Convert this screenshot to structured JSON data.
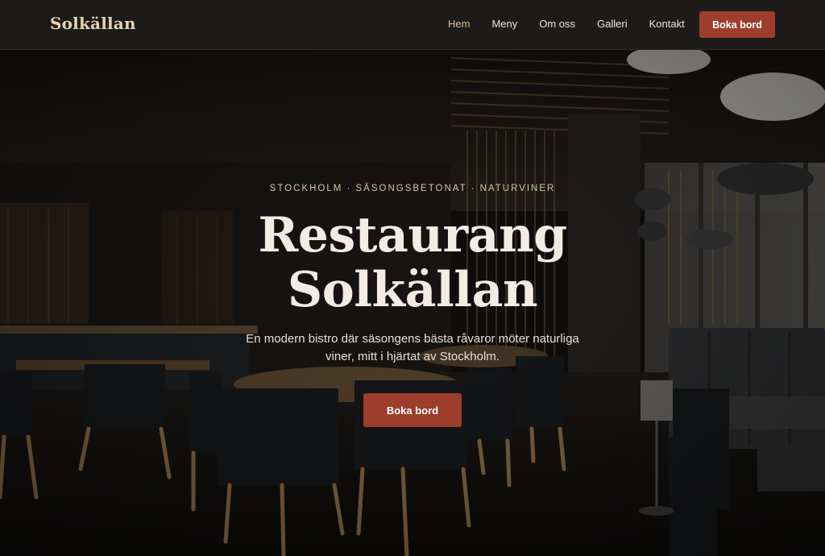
{
  "brand": {
    "name": "Solkällan"
  },
  "nav": {
    "items": [
      {
        "label": "Hem",
        "active": true
      },
      {
        "label": "Meny",
        "active": false
      },
      {
        "label": "Om oss",
        "active": false
      },
      {
        "label": "Galleri",
        "active": false
      },
      {
        "label": "Kontakt",
        "active": false
      }
    ],
    "cta_label": "Boka bord"
  },
  "hero": {
    "eyebrow": "STOCKHOLM · SÄSONGSBETONAT · NATURVINER",
    "title_line1": "Restaurang",
    "title_line2": "Solkällan",
    "subtitle": "En modern bistro där säsongens bästa råvaror möter naturliga viner, mitt i hjärtat av Stockholm.",
    "cta_label": "Boka bord",
    "background_image": "restaurant-interior-photo"
  },
  "colors": {
    "nav_bg": "#1c1b1a",
    "brand": "#e6d3b0",
    "accent": "#9d3e2c",
    "active_link": "#d9bf93",
    "eyebrow": "#d8c6a3"
  }
}
